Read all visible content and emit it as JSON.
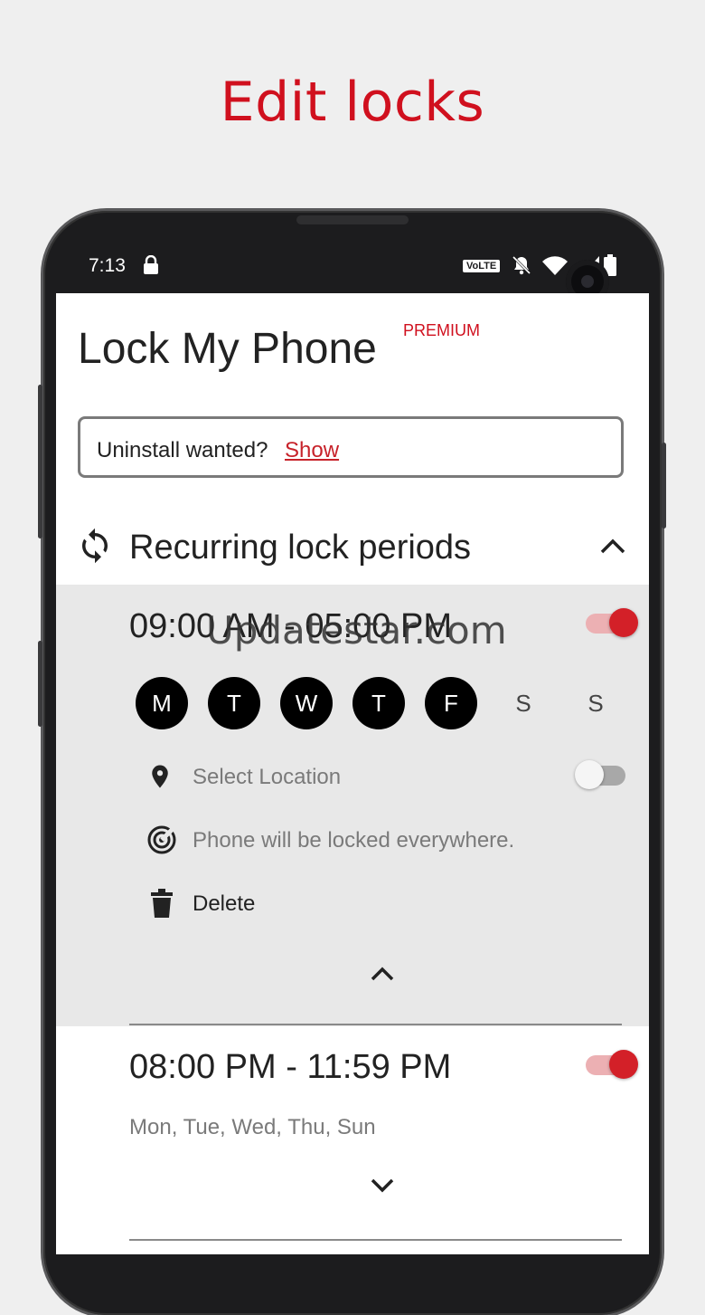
{
  "promo": {
    "title": "Edit locks"
  },
  "status_bar": {
    "time": "7:13",
    "volte": "VoLTE"
  },
  "app": {
    "title": "Lock My Phone",
    "badge": "PREMIUM"
  },
  "uninstall": {
    "text": "Uninstall wanted?",
    "link": "Show"
  },
  "section": {
    "title": "Recurring lock periods"
  },
  "watermark": "Updatestar.com",
  "periods": [
    {
      "start": "09:00 AM",
      "separator": "-",
      "end": "05:00 PM",
      "enabled": true,
      "expanded": true,
      "days": [
        {
          "label": "M",
          "active": true
        },
        {
          "label": "T",
          "active": true
        },
        {
          "label": "W",
          "active": true
        },
        {
          "label": "T",
          "active": true
        },
        {
          "label": "F",
          "active": true
        },
        {
          "label": "S",
          "active": false
        },
        {
          "label": "S",
          "active": false
        }
      ],
      "location": {
        "label": "Select Location",
        "enabled": false
      },
      "scope_text": "Phone will be locked everywhere.",
      "delete_label": "Delete"
    },
    {
      "start": "08:00 PM",
      "separator": "-",
      "end": "11:59 PM",
      "enabled": true,
      "expanded": false,
      "days_summary": "Mon, Tue, Wed, Thu, Sun"
    }
  ],
  "colors": {
    "accent": "#d32028",
    "promo_red": "#d0101e",
    "card_bg": "#e8e8e8"
  },
  "icons": [
    "lock-icon",
    "bell-off-icon",
    "wifi-icon",
    "signal-icon",
    "battery-icon",
    "sync-icon",
    "chevron-up-icon",
    "location-pin-icon",
    "radar-icon",
    "trash-icon",
    "chevron-down-icon"
  ]
}
